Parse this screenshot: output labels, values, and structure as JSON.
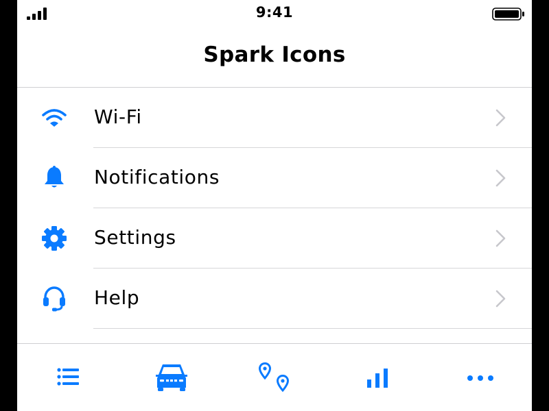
{
  "status_bar": {
    "time": "9:41",
    "icons": [
      "signal-icon",
      "battery-icon"
    ]
  },
  "nav": {
    "title": "Spark Icons"
  },
  "list": {
    "items": [
      {
        "label": "Wi-Fi",
        "icon": "wifi-icon"
      },
      {
        "label": "Notifications",
        "icon": "bell-icon"
      },
      {
        "label": "Settings",
        "icon": "gear-icon"
      },
      {
        "label": "Help",
        "icon": "headset-icon"
      }
    ],
    "chevron_icon": "chevron-right-icon"
  },
  "tab_bar": {
    "tabs": [
      {
        "icon": "list-icon"
      },
      {
        "icon": "car-icon"
      },
      {
        "icon": "map-pins-icon"
      },
      {
        "icon": "bar-chart-icon"
      },
      {
        "icon": "more-dots-icon"
      }
    ]
  },
  "colors": {
    "accent": "#0a7bff",
    "separator": "#d6d6d8",
    "chevron": "#c7c7cc",
    "text": "#000000",
    "background": "#ffffff",
    "frame": "#000000"
  }
}
